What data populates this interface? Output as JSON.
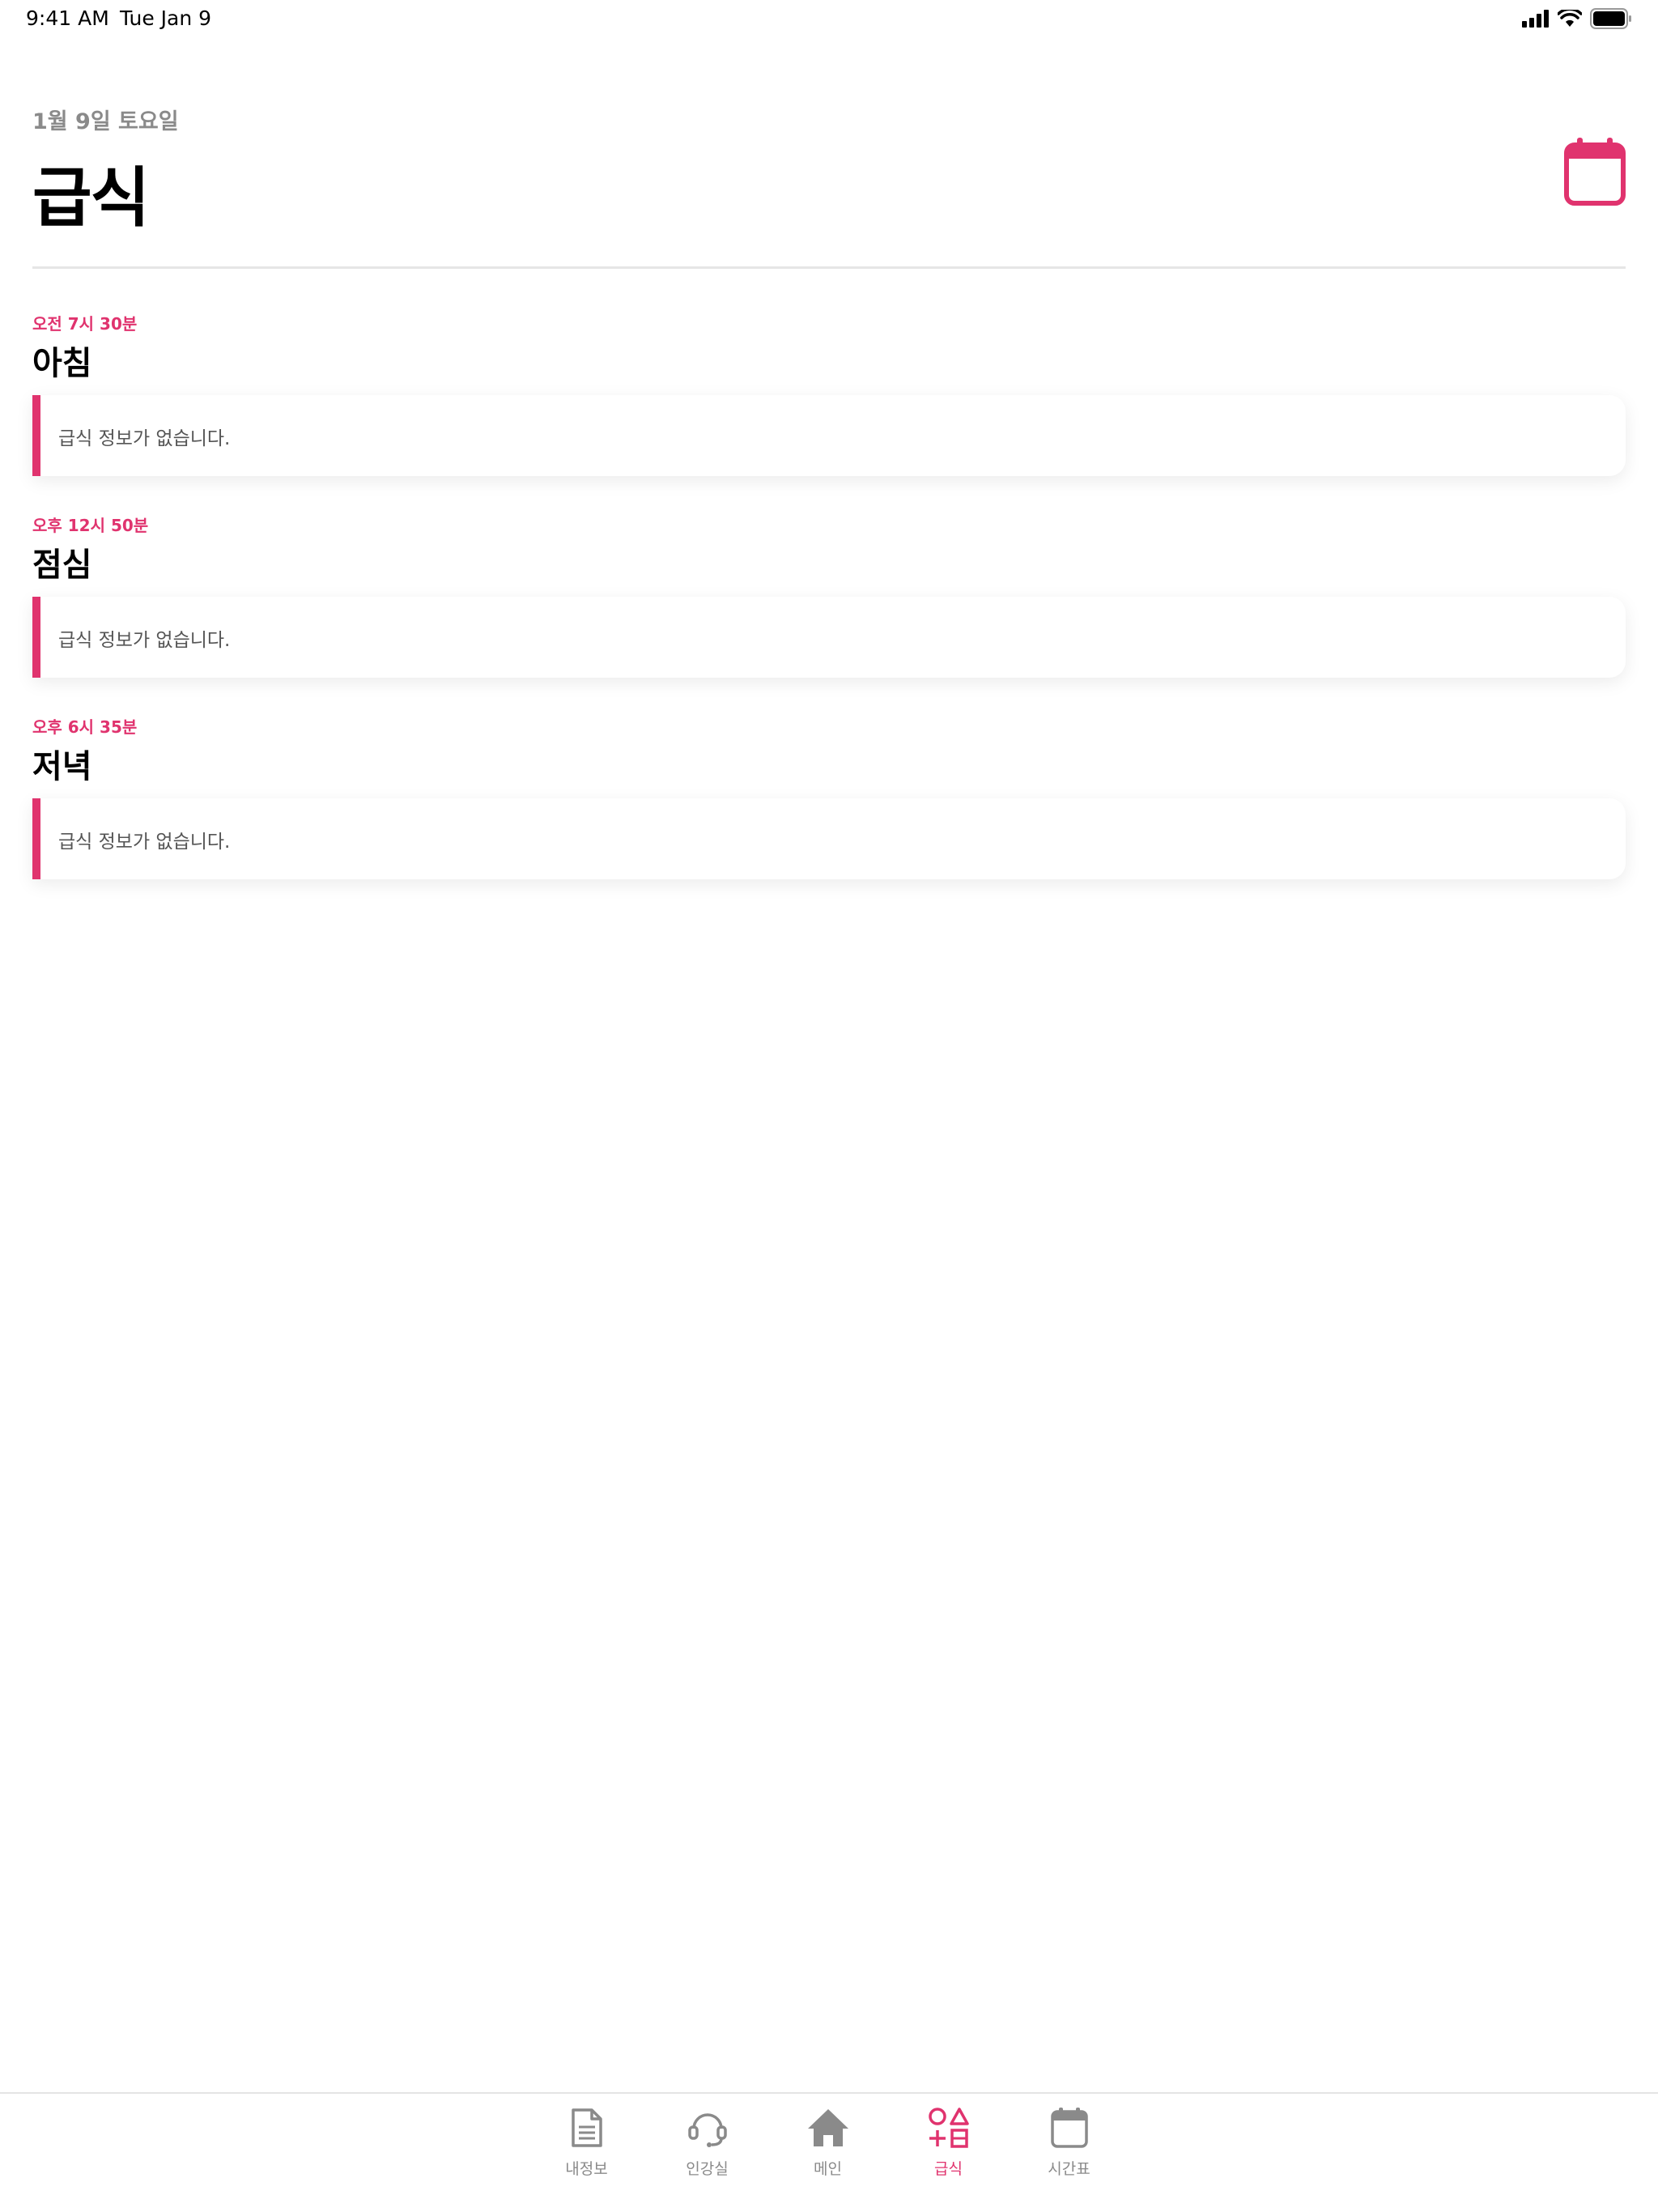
{
  "status_bar": {
    "time": "9:41 AM",
    "date": "Tue Jan 9"
  },
  "header": {
    "date": "1월 9일 토요일",
    "title": "급식"
  },
  "colors": {
    "accent": "#e0336e",
    "inactive": "#8a8a8a"
  },
  "meals": [
    {
      "time": "오전 7시 30분",
      "name": "아침",
      "content": "급식 정보가 없습니다."
    },
    {
      "time": "오후 12시 50분",
      "name": "점심",
      "content": "급식 정보가 없습니다."
    },
    {
      "time": "오후 6시 35분",
      "name": "저녁",
      "content": "급식 정보가 없습니다."
    }
  ],
  "tab_bar": {
    "active": "급식",
    "tabs": [
      {
        "label": "내정보",
        "icon": "document-icon"
      },
      {
        "label": "인강실",
        "icon": "headset-icon"
      },
      {
        "label": "메인",
        "icon": "home-icon"
      },
      {
        "label": "급식",
        "icon": "shapes-icon"
      },
      {
        "label": "시간표",
        "icon": "calendar-icon"
      }
    ]
  }
}
